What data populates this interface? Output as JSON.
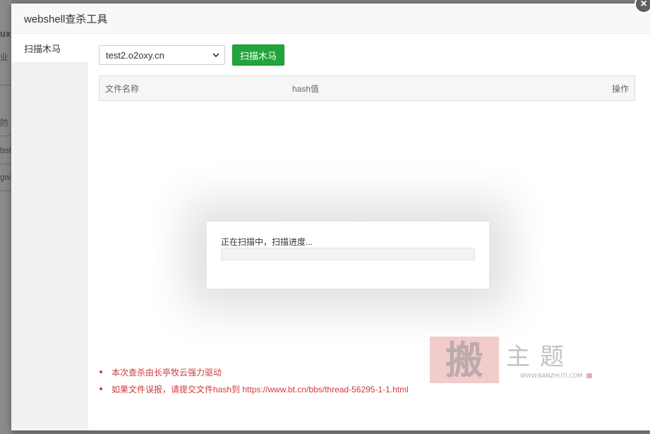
{
  "background": {
    "fragments": [
      "ux",
      "业",
      "防",
      "bsh",
      "gw"
    ]
  },
  "dialog": {
    "title": "webshell查杀工具",
    "close_icon": "×"
  },
  "sidebar": {
    "items": [
      {
        "label": "扫描木马"
      }
    ]
  },
  "toolbar": {
    "site_select_value": "test2.o2oxy.cn",
    "scan_button": "扫描木马"
  },
  "table": {
    "columns": [
      "文件名称",
      "hash值",
      "操作"
    ],
    "rows": []
  },
  "progress": {
    "label": "正在扫描中，扫描进度...",
    "percent": 0
  },
  "notes": [
    "本次查杀由长亭牧云强力驱动",
    "如果文件误报，请提交文件hash到 https://www.bt.cn/bbs/thread-56295-1-1.html"
  ],
  "watermark": {
    "big_text": "搬主题",
    "url_text": "WWW.BANZHUTI.COM"
  },
  "colors": {
    "accent": "#20a53a",
    "note_red": "#cf3b3b",
    "overlay": "#7f7f7f"
  }
}
